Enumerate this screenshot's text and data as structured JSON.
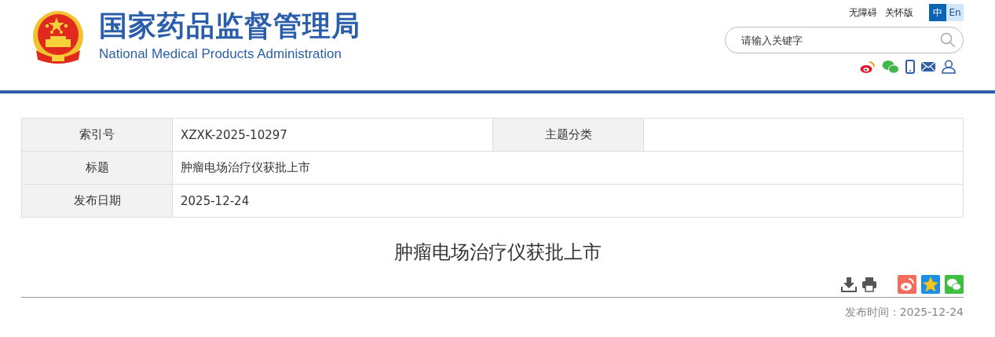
{
  "header": {
    "title_cn": "国家药品监督管理局",
    "title_en": "National Medical Products Administration",
    "top_links": [
      "无障碍",
      "关怀版"
    ],
    "languages": [
      {
        "label": "中",
        "selected": true
      },
      {
        "label": "En",
        "selected": false
      }
    ],
    "search": {
      "placeholder": "请输入关键字"
    }
  },
  "info_table": {
    "rows": [
      {
        "cells": [
          {
            "kind": "label",
            "text": "索引号"
          },
          {
            "kind": "value",
            "text": "XZXK-2025-10297"
          },
          {
            "kind": "label",
            "text": "主题分类"
          }
        ]
      },
      {
        "cells": [
          {
            "kind": "label",
            "text": "标题"
          },
          {
            "kind": "value",
            "text": "肿瘤电场治疗仪获批上市"
          }
        ]
      },
      {
        "cells": [
          {
            "kind": "label",
            "text": "发布日期"
          },
          {
            "kind": "value",
            "text": "2025-12-24"
          }
        ]
      }
    ]
  },
  "article": {
    "title": "肿瘤电场治疗仪获批上市",
    "publish_time": "发布时间：2025-12-24"
  }
}
